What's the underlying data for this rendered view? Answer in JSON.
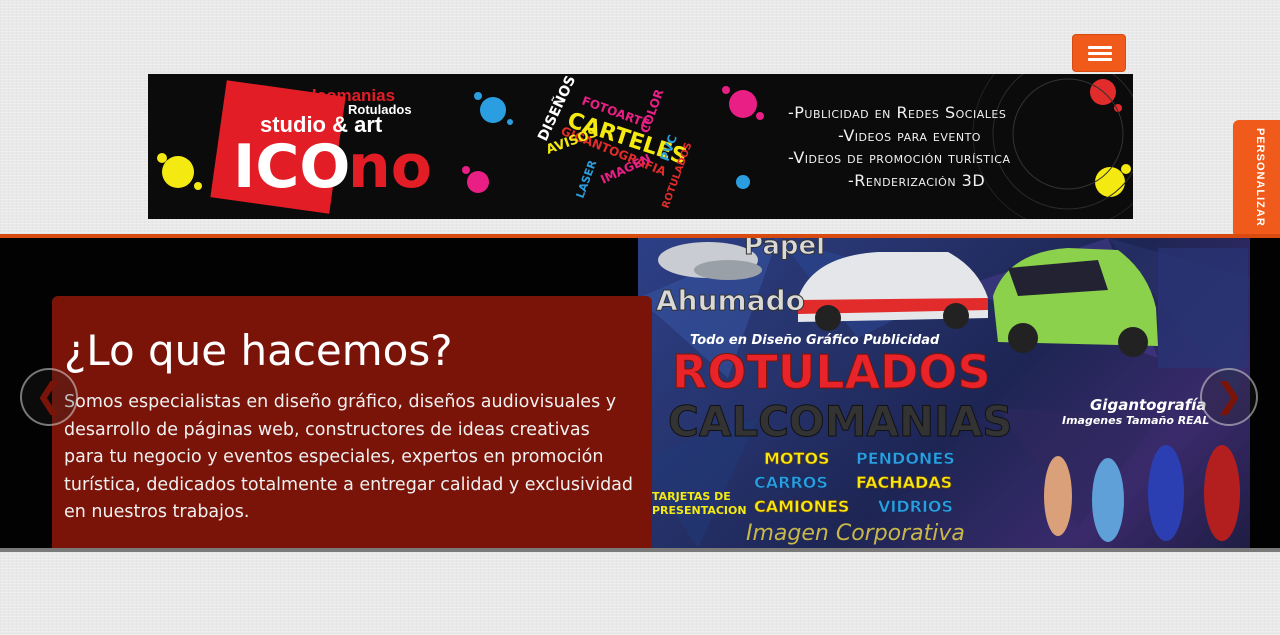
{
  "nav": {
    "menu_icon": "hamburger-icon",
    "personalize_label": "PERSONALIZAR"
  },
  "banner": {
    "logo": {
      "top_text": "calcomanias",
      "sub_text": "Rotulados",
      "studio_text": "studio & art",
      "brand_part1": "ICO",
      "brand_part2": "no"
    },
    "word_cloud": [
      "DISEÑOS",
      "FOTOARTE",
      "COLOR",
      "CARTELES",
      "PVC",
      "GIGANTOGRAFIA",
      "AVISOS",
      "LASER",
      "IMAGEN",
      "ROTULADOS"
    ],
    "services": [
      "-Publicidad en Redes Sociales",
      "-Videos para evento",
      "-Videos de promoción turística",
      "-Renderización 3D"
    ]
  },
  "hero": {
    "title": "¿Lo que hacemos?",
    "description": "Somos especialistas en diseño gráfico, diseños audiovisuales y desarrollo de páginas web, constructores de ideas creativas para tu negocio y eventos especiales, expertos en promoción turística, dedicados totalmente a entregar calidad y exclusividad en nuestros trabajos.",
    "prev_icon": "chevron-left-icon",
    "next_icon": "chevron-right-icon",
    "prev_glyph": "❮",
    "next_glyph": "❯",
    "image_text": {
      "top_left_1": "Papel",
      "top_left_2": "Ahumado",
      "tagline": "Todo en Diseño Gráfico Publicidad",
      "headline_1": "ROTULADOS",
      "headline_2": "CALCOMANIAS",
      "gigantografia": "Gigantografía",
      "gigantografia_sub": "Imagenes Tamaño REAL",
      "item_motos": "MOTOS",
      "item_carros": "CARROS",
      "item_camiones": "CAMIONES",
      "item_pendones": "PENDONES",
      "item_fachadas": "FACHADAS",
      "item_vidrios": "VIDRIOS",
      "tarjetas_1": "TARJETAS DE",
      "tarjetas_2": "PRESENTACION",
      "footer": "Imagen Corporativa"
    }
  },
  "colors": {
    "accent": "#f05a1a",
    "caption_bg": "#7a1409",
    "banner_bg": "#0b0b0b",
    "page_bg": "#e9e9e9"
  }
}
